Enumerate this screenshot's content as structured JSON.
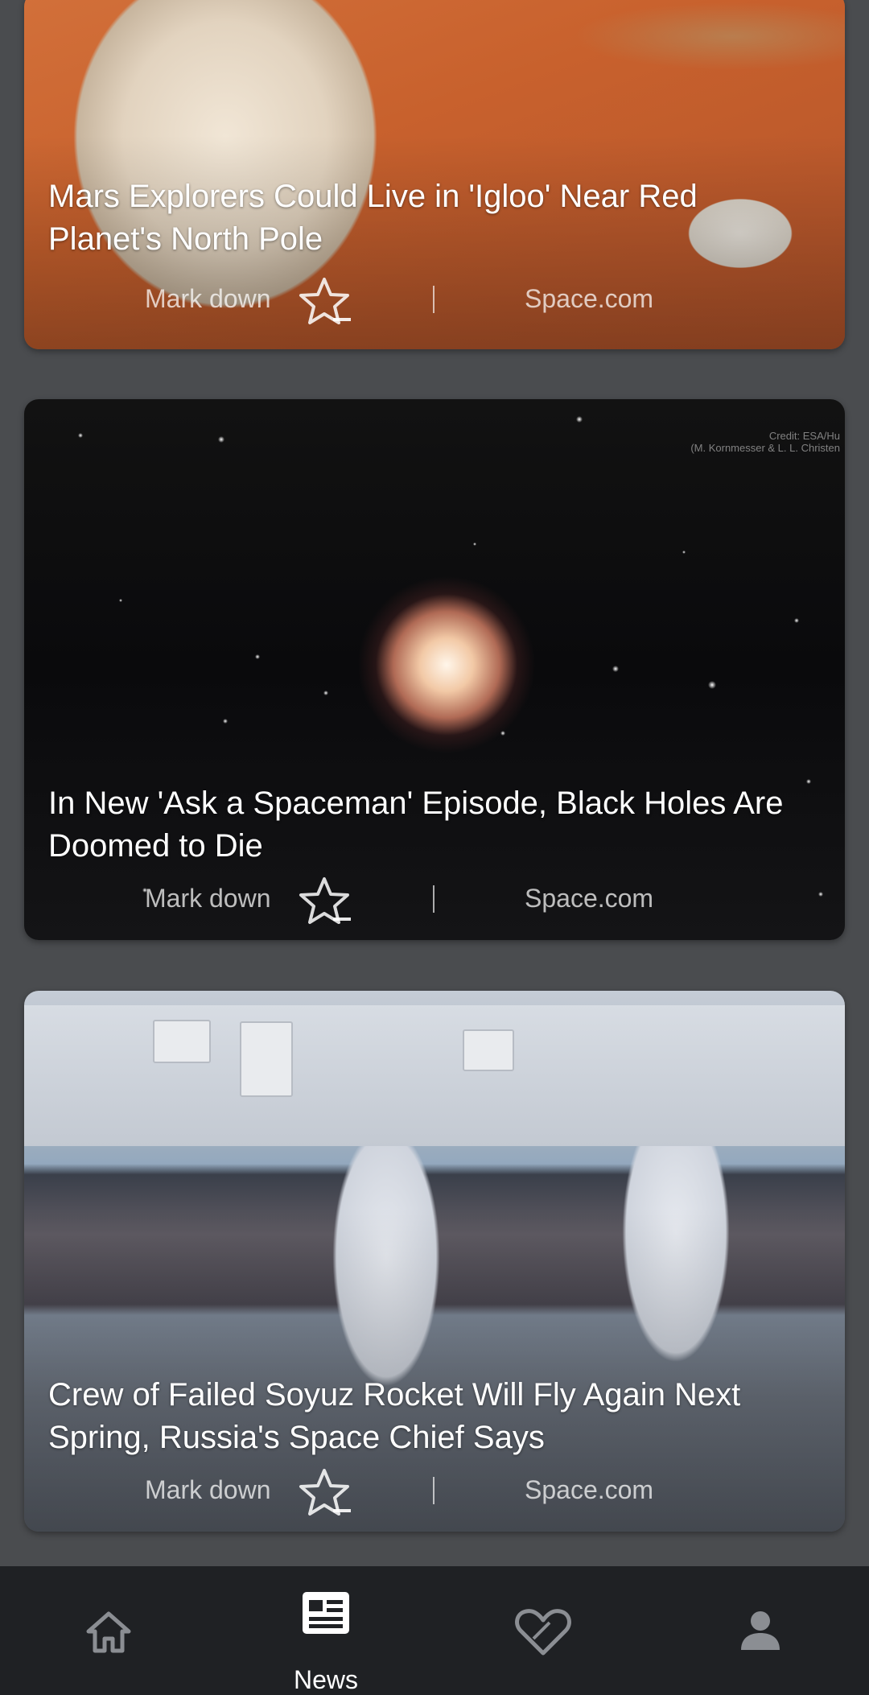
{
  "feed": {
    "cards": [
      {
        "title": "Mars Explorers Could Live in 'Igloo' Near Red Planet's North Pole",
        "mark_label": "Mark down",
        "source": "Space.com"
      },
      {
        "title": "In New 'Ask a Spaceman' Episode, Black Holes Are Doomed to Die",
        "image_credit_line1": "Credit: ESA/Hu",
        "image_credit_line2": "(M. Kornmesser & L. L. Christen",
        "mark_label": "Mark down",
        "source": "Space.com"
      },
      {
        "title": "Crew of Failed Soyuz Rocket Will Fly Again Next Spring, Russia's Space Chief Says",
        "mark_label": "Mark down",
        "source": "Space.com"
      }
    ]
  },
  "bottom_nav": {
    "items": [
      {
        "icon": "home-icon",
        "label": ""
      },
      {
        "icon": "news-icon",
        "label": "News",
        "active": true
      },
      {
        "icon": "heart-icon",
        "label": ""
      },
      {
        "icon": "profile-icon",
        "label": ""
      }
    ]
  },
  "colors": {
    "background": "#4a4c4f",
    "nav_background": "#1f2124",
    "active_icon": "#ffffff",
    "inactive_icon": "#8b8e93"
  }
}
